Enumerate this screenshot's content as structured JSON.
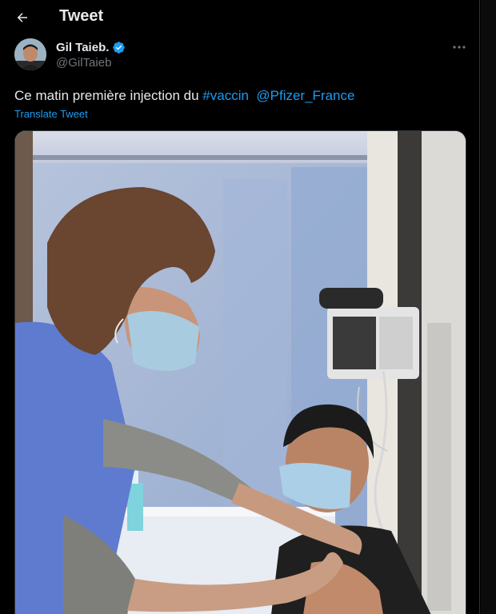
{
  "header": {
    "title": "Tweet",
    "back_icon": "arrow-left-icon"
  },
  "tweet": {
    "author": {
      "display_name": "Gil Taieb.",
      "handle": "@GilTaieb",
      "verified": true,
      "verified_color": "#1d9bf0"
    },
    "text": {
      "prefix": "Ce matin première injection du ",
      "hashtag": "#vaccin",
      "mention": "@Pfizer_France"
    },
    "translate_label": "Translate Tweet",
    "more_icon": "more-horizontal-icon"
  },
  "colors": {
    "background": "#000000",
    "text": "#e7e9ea",
    "secondary": "#71767b",
    "link": "#1d9bf0"
  }
}
